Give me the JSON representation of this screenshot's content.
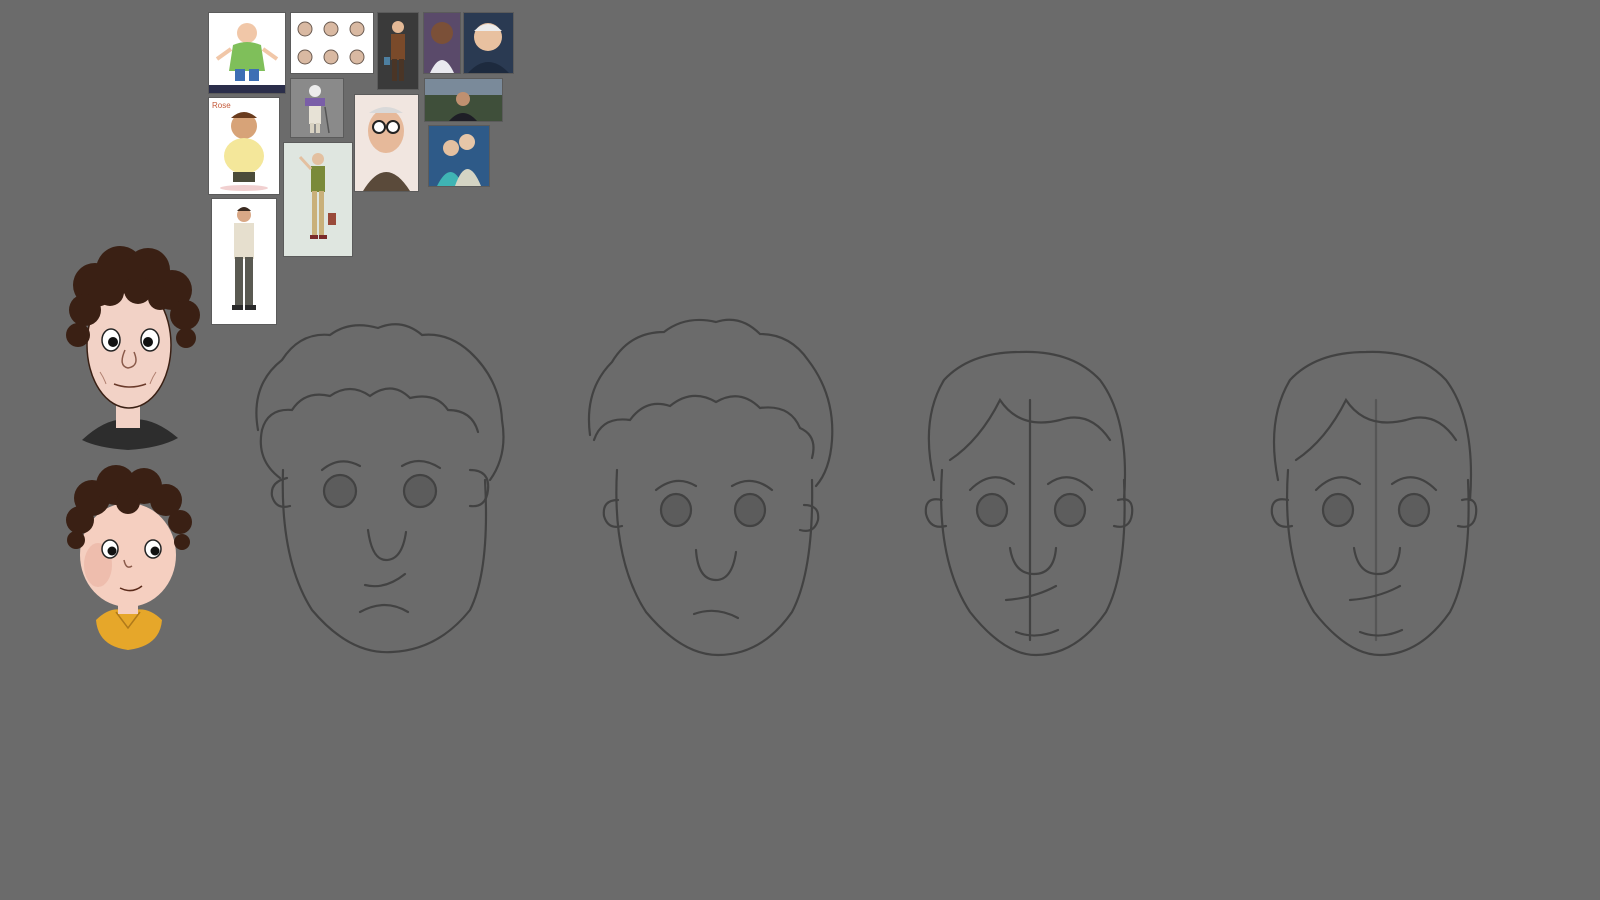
{
  "canvas": {
    "background": "#6b6b6b"
  },
  "reference_board": {
    "logo_text": "Rose",
    "items": [
      "cartoon-old-man-blue-shirt",
      "head-turnaround-sheet",
      "old-man-dark-coat",
      "elderly-man-photo-portrait",
      "elderly-man-smiling-photo",
      "chubby-man-cartoon",
      "old-man-with-cane",
      "glasses-old-man-3d",
      "man-outdoor-photo",
      "elderly-couple-3d",
      "tall-old-man-waving",
      "man-standing-arms-crossed"
    ]
  },
  "colored_heads": [
    {
      "name": "older-curly-head",
      "hair": "#3a2014",
      "skin": "#f2d2c6",
      "shirt": "#2d2d2d"
    },
    {
      "name": "young-curly-head",
      "hair": "#3a2014",
      "skin": "#f5cfc0",
      "shirt": "#e6a72a"
    }
  ],
  "sketches": [
    "curly-hair-sad-face-sketch",
    "curly-hair-neutral-face-sketch",
    "straight-hair-face-sketch",
    "straight-hair-face-sketch-clean"
  ]
}
